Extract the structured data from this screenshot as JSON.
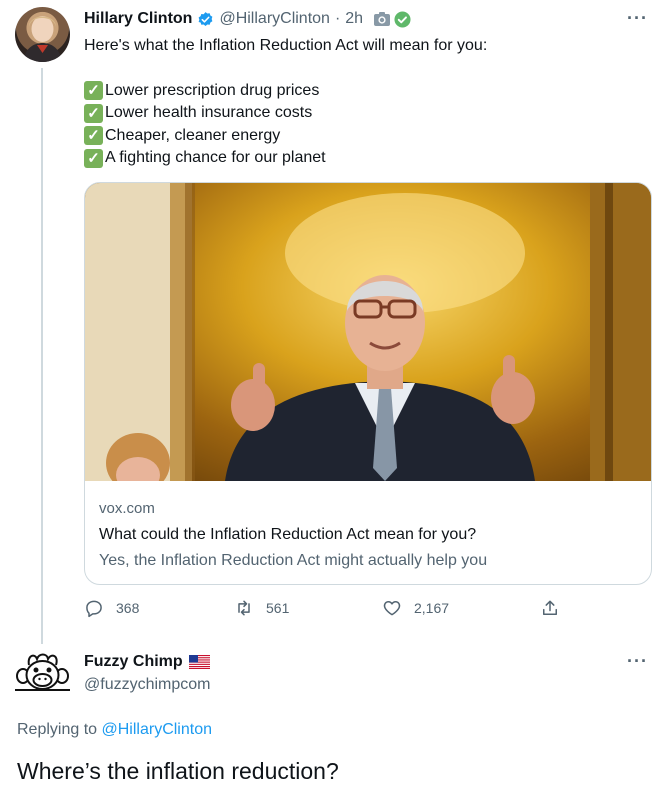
{
  "tweet": {
    "author_name": "Hillary Clinton",
    "handle": "@HillaryClinton",
    "separator": "·",
    "time": "2h",
    "more_label": "···",
    "intro": "Here's what the Inflation Reduction Act will mean for you:",
    "check_glyph": "✓",
    "points": [
      "Lower prescription drug prices",
      "Lower health insurance costs",
      "Cheaper, cleaner energy",
      "A fighting chance for our planet"
    ],
    "card": {
      "domain": "vox.com",
      "title": "What could the Inflation Reduction Act mean for you?",
      "description": "Yes, the Inflation Reduction Act might actually help you"
    },
    "stats": {
      "replies": "368",
      "retweets": "561",
      "likes": "2,167"
    },
    "colors": {
      "verified_blue": "#1d9bf0",
      "check_green": "#78b159",
      "muted_text": "#536471"
    }
  },
  "reply": {
    "author_name": "Fuzzy Chimp",
    "handle": "@fuzzychimpcom",
    "more_label": "···",
    "replying_prefix": "Replying to",
    "replying_to": "@HillaryClinton",
    "text": "Where’s the inflation reduction?"
  }
}
